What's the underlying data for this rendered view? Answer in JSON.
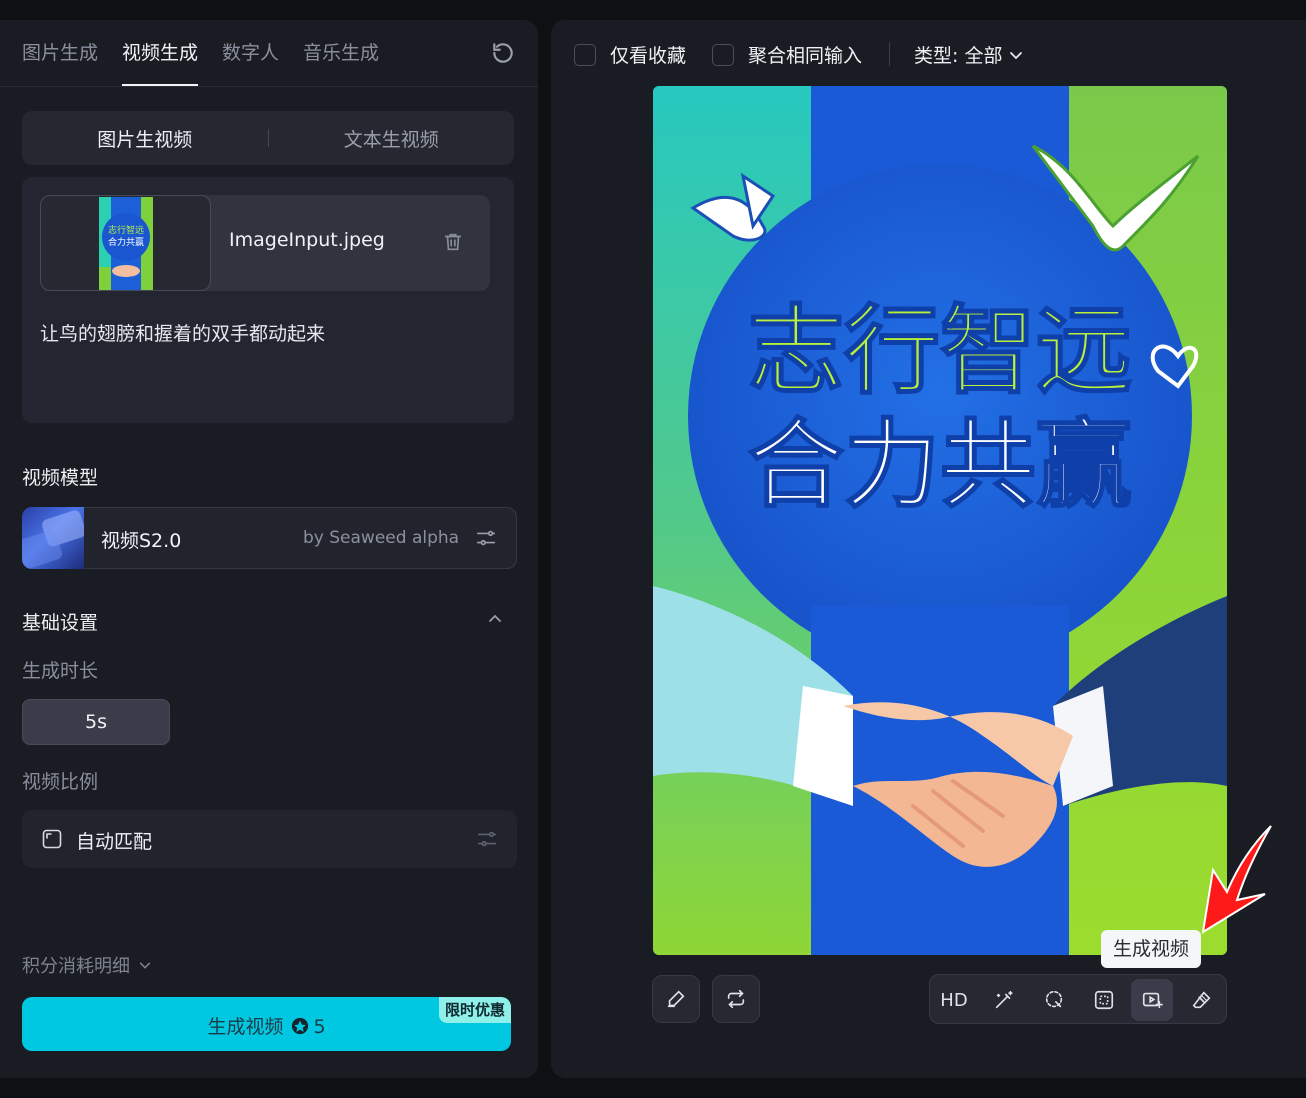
{
  "left": {
    "tabs": [
      {
        "label": "图片生成",
        "active": false
      },
      {
        "label": "视频生成",
        "active": true
      },
      {
        "label": "数字人",
        "active": false
      },
      {
        "label": "音乐生成",
        "active": false
      }
    ],
    "mode_tabs": [
      {
        "label": "图片生视频",
        "active": true
      },
      {
        "label": "文本生视频",
        "active": false
      }
    ],
    "file_name": "ImageInput.jpeg",
    "prompt": "让鸟的翅膀和握着的双手都动起来",
    "model_section_title": "视频模型",
    "model": {
      "name": "视频S2.0",
      "by": "by Seaweed alpha"
    },
    "basic_settings_title": "基础设置",
    "duration_label": "生成时长",
    "duration_value": "5s",
    "ratio_label": "视频比例",
    "ratio_value": "自动匹配",
    "points_detail": "积分消耗明细",
    "generate_label": "生成视频",
    "generate_cost": "5",
    "promo_badge": "限时优惠"
  },
  "right": {
    "filters": [
      {
        "label": "仅看收藏",
        "checked": false
      },
      {
        "label": "聚合相同输入",
        "checked": false
      }
    ],
    "type_filter": "类型: 全部",
    "poster": {
      "line1": "志行智远",
      "line2": "合力共赢"
    },
    "toolbar": {
      "hd_label": "HD",
      "active_tool": "generate-video",
      "tooltip": "生成视频"
    }
  },
  "colors": {
    "accent": "#00c8e0",
    "panel": "#1a1c23",
    "background": "#0f1014",
    "annotation_arrow": "#ff1a1a"
  }
}
